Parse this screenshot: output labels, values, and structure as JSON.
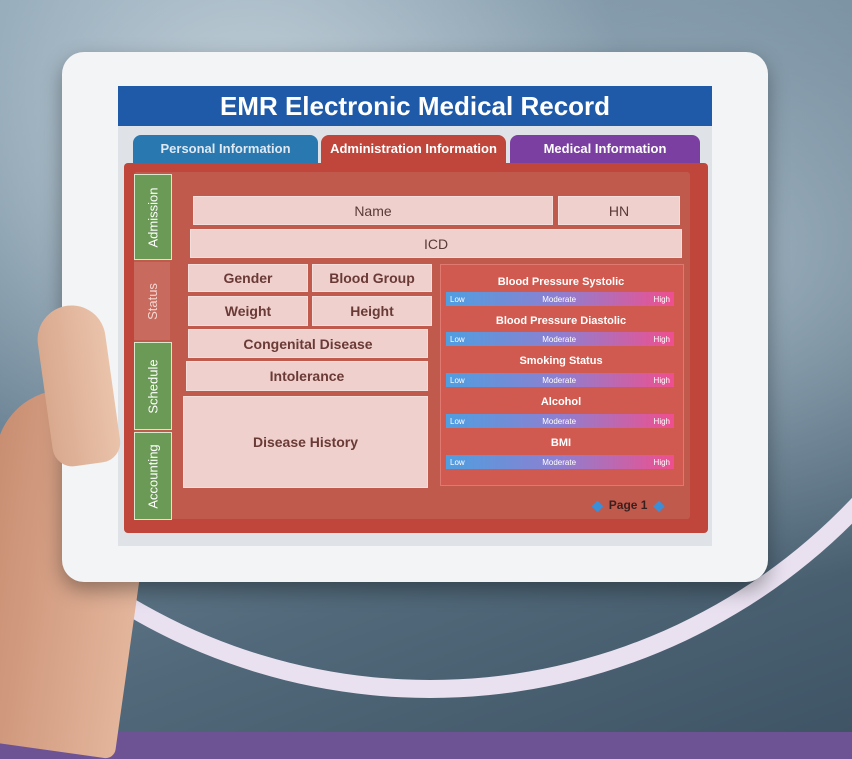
{
  "app": {
    "title": "EMR Electronic Medical Record"
  },
  "tabs": [
    {
      "label": "Personal Information"
    },
    {
      "label": "Administration Information"
    },
    {
      "label": "Medical  Information"
    }
  ],
  "side_tabs": [
    {
      "label": "Admission"
    },
    {
      "label": "Status"
    },
    {
      "label": "Schedule"
    },
    {
      "label": "Accounting"
    }
  ],
  "fields": {
    "name": "Name",
    "hn": "HN",
    "icd": "ICD",
    "gender": "Gender",
    "blood_group": "Blood Group",
    "weight": "Weight",
    "height": "Height",
    "congenital_disease": "Congenital Disease",
    "intolerance": "Intolerance",
    "disease_history": "Disease History"
  },
  "metrics": [
    {
      "title": "Blood Pressure Systolic",
      "low": "Low",
      "moderate": "Moderate",
      "high": "High"
    },
    {
      "title": "Blood Pressure Diastolic",
      "low": "Low",
      "moderate": "Moderate",
      "high": "High"
    },
    {
      "title": "Smoking Status",
      "low": "Low",
      "moderate": "Moderate",
      "high": "High"
    },
    {
      "title": "Alcohol",
      "low": "Low",
      "moderate": "Moderate",
      "high": "High"
    },
    {
      "title": "BMI",
      "low": "Low",
      "moderate": "Moderate",
      "high": "High"
    }
  ],
  "pager": {
    "label": "Page 1",
    "prev_icon": "arrow-left-icon",
    "next_icon": "arrow-right-icon"
  },
  "colors": {
    "title_bar": "#1e5aa8",
    "personal_tab": "#2a78b0",
    "admin_tab": "#c0453a",
    "medical_tab": "#7b3fa2",
    "side_tab": "#6a9a55",
    "background_purple": "#6e5394"
  }
}
